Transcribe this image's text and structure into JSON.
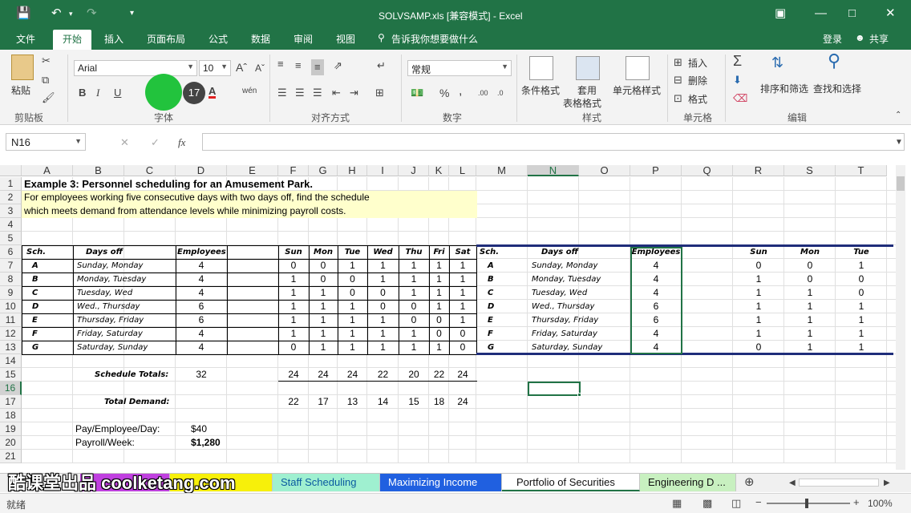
{
  "title_bar": {
    "title": "SOLVSAMP.xls [兼容模式] - Excel"
  },
  "menu": {
    "tabs": [
      "文件",
      "开始",
      "插入",
      "页面布局",
      "公式",
      "数据",
      "审阅",
      "视图"
    ],
    "tell_me": "告诉我你想要做什么",
    "login": "登录",
    "share": "共享"
  },
  "ribbon": {
    "clipboard": {
      "paste": "粘贴",
      "label": "剪贴板"
    },
    "font": {
      "name": "Arial",
      "size": "10",
      "label": "字体",
      "badge": "17"
    },
    "alignment": {
      "label": "对齐方式"
    },
    "number": {
      "format": "常规",
      "label": "数字"
    },
    "styles": {
      "conditional": "条件格式",
      "table": "套用",
      "table2": "表格格式",
      "cell": "单元格样式",
      "label": "样式"
    },
    "cells": {
      "insert": "插入",
      "delete": "删除",
      "format": "格式",
      "label": "单元格"
    },
    "editing": {
      "sort": "排序和筛选",
      "find": "查找和选择",
      "label": "编辑"
    }
  },
  "formula_bar": {
    "name_box": "N16",
    "fx": "fx",
    "value": ""
  },
  "columns": [
    "A",
    "B",
    "C",
    "D",
    "E",
    "F",
    "G",
    "H",
    "I",
    "J",
    "K",
    "L",
    "M",
    "N",
    "O",
    "P",
    "Q",
    "R",
    "S",
    "T"
  ],
  "rows": [
    "1",
    "2",
    "3",
    "4",
    "5",
    "6",
    "7",
    "8",
    "9",
    "10",
    "11",
    "12",
    "13",
    "14",
    "15",
    "16",
    "17",
    "18",
    "19",
    "20",
    "21"
  ],
  "sheet": {
    "title": "Example 3:  Personnel scheduling for an Amusement Park.",
    "desc1": "For employees working five consecutive days with two days off, find the schedule",
    "desc2": "which meets demand from attendance levels while minimizing payroll costs.",
    "headers": {
      "sch": "Sch.",
      "days_off": "Days off",
      "employees": "Employees",
      "days": [
        "Sun",
        "Mon",
        "Tue",
        "Wed",
        "Thu",
        "Fri",
        "Sat"
      ]
    },
    "schedules": [
      {
        "sch": "A",
        "off": "Sunday, Monday",
        "emp": "4",
        "days": [
          "0",
          "0",
          "1",
          "1",
          "1",
          "1",
          "1"
        ]
      },
      {
        "sch": "B",
        "off": "Monday, Tuesday",
        "emp": "4",
        "days": [
          "1",
          "0",
          "0",
          "1",
          "1",
          "1",
          "1"
        ]
      },
      {
        "sch": "C",
        "off": "Tuesday, Wed",
        "emp": "4",
        "days": [
          "1",
          "1",
          "0",
          "0",
          "1",
          "1",
          "1"
        ]
      },
      {
        "sch": "D",
        "off": "Wed., Thursday",
        "emp": "6",
        "days": [
          "1",
          "1",
          "1",
          "0",
          "0",
          "1",
          "1"
        ]
      },
      {
        "sch": "E",
        "off": "Thursday, Friday",
        "emp": "6",
        "days": [
          "1",
          "1",
          "1",
          "1",
          "0",
          "0",
          "1"
        ]
      },
      {
        "sch": "F",
        "off": "Friday, Saturday",
        "emp": "4",
        "days": [
          "1",
          "1",
          "1",
          "1",
          "1",
          "0",
          "0"
        ]
      },
      {
        "sch": "G",
        "off": "Saturday, Sunday",
        "emp": "4",
        "days": [
          "0",
          "1",
          "1",
          "1",
          "1",
          "1",
          "0"
        ]
      }
    ],
    "totals_label": "Schedule Totals:",
    "totals_emp": "32",
    "totals": [
      "24",
      "24",
      "24",
      "22",
      "20",
      "22",
      "24"
    ],
    "demand_label": "Total Demand:",
    "demand": [
      "22",
      "17",
      "13",
      "14",
      "15",
      "18",
      "24"
    ],
    "pay_label": "Pay/Employee/Day:",
    "pay_value": "$40",
    "payroll_label": "Payroll/Week:",
    "payroll_value": "$1,280",
    "right_headers": {
      "sch": "Sch.",
      "days_off": "Days off",
      "employees": "Employees",
      "days": [
        "Sun",
        "Mon",
        "Tue"
      ]
    },
    "right_rows": [
      {
        "sch": "A",
        "off": "Sunday, Monday",
        "emp": "4",
        "days": [
          "0",
          "0",
          "1"
        ]
      },
      {
        "sch": "B",
        "off": "Monday, Tuesday",
        "emp": "4",
        "days": [
          "1",
          "0",
          "0"
        ]
      },
      {
        "sch": "C",
        "off": "Tuesday, Wed",
        "emp": "4",
        "days": [
          "1",
          "1",
          "0"
        ]
      },
      {
        "sch": "D",
        "off": "Wed., Thursday",
        "emp": "6",
        "days": [
          "1",
          "1",
          "1"
        ]
      },
      {
        "sch": "E",
        "off": "Thursday, Friday",
        "emp": "6",
        "days": [
          "1",
          "1",
          "1"
        ]
      },
      {
        "sch": "F",
        "off": "Friday, Saturday",
        "emp": "4",
        "days": [
          "1",
          "1",
          "1"
        ]
      },
      {
        "sch": "G",
        "off": "Saturday, Sunday",
        "emp": "4",
        "days": [
          "0",
          "1",
          "1"
        ]
      }
    ]
  },
  "sheet_tabs": [
    "Staff Scheduling",
    "Maximizing Income",
    "Portfolio of Securities",
    "Engineering D ..."
  ],
  "status": {
    "ready": "就绪",
    "zoom": "100%"
  },
  "watermark": "酷课堂出品 coolketang.com",
  "colors": {
    "excel_green": "#217346",
    "highlight_yellow": "#ffffcc",
    "navy": "#1f2d7a"
  }
}
